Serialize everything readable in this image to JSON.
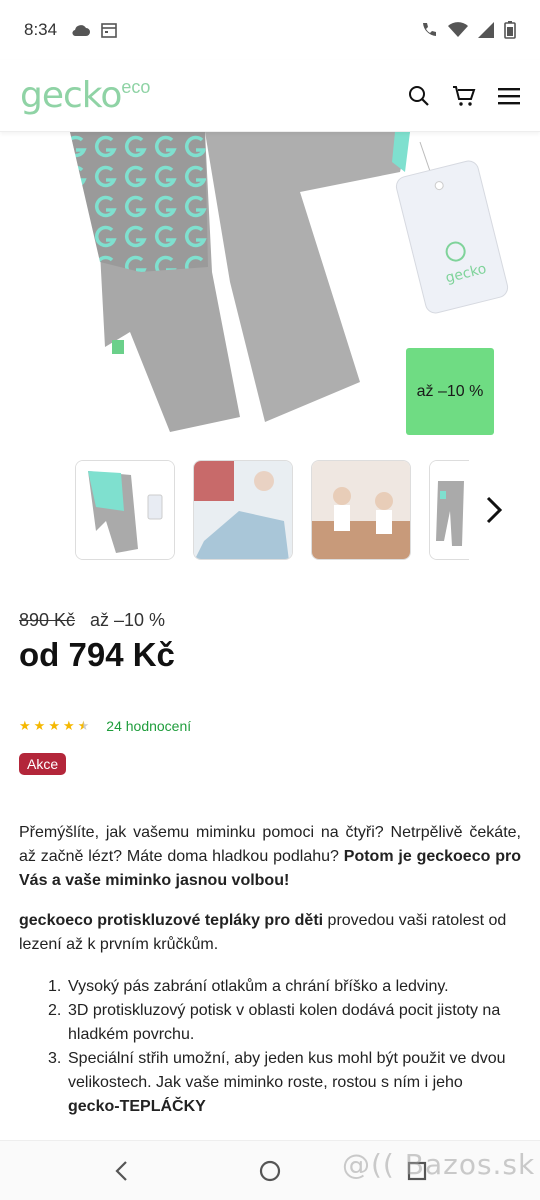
{
  "status_bar": {
    "time": "8:34"
  },
  "header": {
    "logo_main": "gecko",
    "logo_sup": "eco"
  },
  "product": {
    "badge": "až –10 %",
    "old_price": "890 Kč",
    "discount": "až –10 %",
    "price": "od 794 Kč",
    "rating_value": 4.5,
    "rating_max": 5,
    "reviews": "24 hodnocení",
    "tag": "Akce"
  },
  "description": {
    "p1_a": "Přemýšlíte, jak vašemu miminku pomoci na čtyři? Netrpělivě čekáte, až začně lézt? Máte doma hladkou podlahu? ",
    "p1_b": "Potom je geckoeco pro Vás a vaše miminko jasnou volbou!",
    "p2_a": "geckoeco protiskluzové tepláky pro děti",
    "p2_b": " provedou vaši ratolest od lezení až k prvním krůčkům.",
    "list": [
      {
        "num": "1.",
        "text": "Vysoký pás zabrání otlakům a chrání bříško a ledviny."
      },
      {
        "num": "2.",
        "text": "3D protiskluzový potisk v oblasti kolen dodává pocit jistoty na hladkém povrchu."
      },
      {
        "num": "3.",
        "text": "Speciální střih umožní, aby jeden kus mohl být použit ve dvou velikostech. Jak vaše miminko roste, rostou s ním i jeho ",
        "bold": "gecko-TEPLÁČKY"
      }
    ]
  },
  "watermark": "@(( Bazos.sk",
  "colors": {
    "brand_green": "#8fd3a5",
    "badge_green": "#6fdc83",
    "akce_red": "#b3263a",
    "review_green": "#1f9d3c",
    "star": "#f5b800"
  }
}
